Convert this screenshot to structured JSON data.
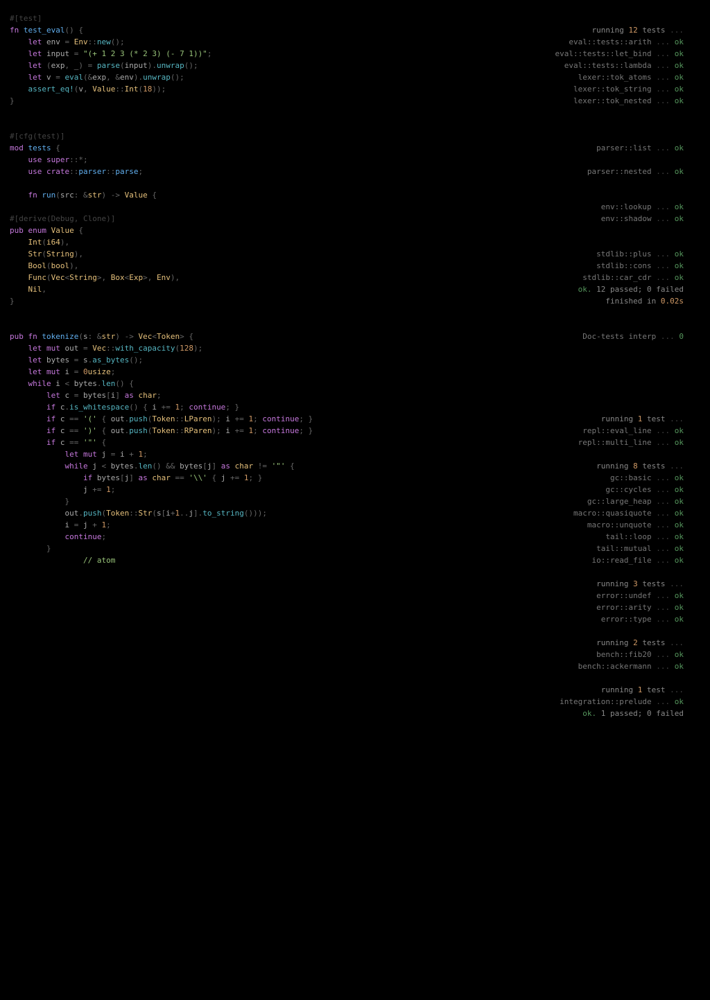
{
  "left": {
    "block1": [
      "#[test]",
      "fn test_eval() {",
      "    let env = Env::new();",
      "    let input = \"(+ 1 2 3 (* 2 3) (- 7 1))\";",
      "    let (exp, _) = parse(input).unwrap();",
      "    let v = eval(&exp, &env).unwrap();",
      "    assert_eq!(v, Value::Int(18));",
      "}"
    ],
    "block2": [
      "",
      "",
      "#[cfg(test)]",
      "mod tests {",
      "    use super::*;",
      "    use crate::parser::parse;"
    ],
    "block3": [
      "",
      "    fn run(src: &str) -> Value {"
    ],
    "block4": [
      "",
      "#[derive(Debug, Clone)]",
      "pub enum Value {",
      "    Int(i64),",
      "    Str(String),",
      "    Bool(bool),",
      "    Func(Vec<String>, Box<Exp>, Env),",
      "    Nil,",
      "}"
    ],
    "block5": [
      "",
      "",
      "pub fn tokenize(s: &str) -> Vec<Token> {",
      "    let mut out = Vec::with_capacity(128);",
      "    let bytes = s.as_bytes();",
      "    let mut i = 0usize;",
      "    while i < bytes.len() {",
      "        let c = bytes[i] as char;",
      "        if c.is_whitespace() { i += 1; continue; }",
      "        if c == '(' { out.push(Token::LParen); i += 1; continue; }",
      "        if c == ')' { out.push(Token::RParen); i += 1; continue; }",
      "        if c == '\"' {",
      "            let mut j = i + 1;",
      "            while j < bytes.len() && bytes[j] as char != '\"' {",
      "                if bytes[j] as char == '\\\\' { j += 1; }",
      "                j += 1;",
      "            }",
      "            out.push(Token::Str(s[i+1..j].to_string()));",
      "            i = j + 1;",
      "            continue;",
      "        }",
      "        // atom"
    ]
  },
  "right": {
    "rows": [
      {
        "kind": "blank"
      },
      {
        "kind": "run",
        "label": "running",
        "count": "12",
        "word": "tests",
        "dots": "..."
      },
      {
        "kind": "ok",
        "loc": "eval::tests::arith",
        "res": "ok"
      },
      {
        "kind": "ok",
        "loc": "eval::tests::let_bind",
        "res": "ok"
      },
      {
        "kind": "ok",
        "loc": "eval::tests::lambda",
        "res": "ok"
      },
      {
        "kind": "ok",
        "loc": "lexer::tok_atoms",
        "res": "ok"
      },
      {
        "kind": "ok",
        "loc": "lexer::tok_string",
        "res": "ok"
      },
      {
        "kind": "ok",
        "loc": "lexer::tok_nested",
        "res": "ok"
      },
      {
        "kind": "blank"
      },
      {
        "kind": "blank"
      },
      {
        "kind": "blank"
      },
      {
        "kind": "ok",
        "loc": "parser::list",
        "res": "ok"
      },
      {
        "kind": "blank"
      },
      {
        "kind": "ok",
        "loc": "parser::nested",
        "res": "ok"
      },
      {
        "kind": "blank"
      },
      {
        "kind": "blank"
      },
      {
        "kind": "ok",
        "loc": "env::lookup",
        "res": "ok"
      },
      {
        "kind": "ok",
        "loc": "env::shadow",
        "res": "ok"
      },
      {
        "kind": "blank"
      },
      {
        "kind": "blank"
      },
      {
        "kind": "ok",
        "loc": "stdlib::plus",
        "res": "ok"
      },
      {
        "kind": "ok",
        "loc": "stdlib::cons",
        "res": "ok"
      },
      {
        "kind": "ok",
        "loc": "stdlib::car_cdr",
        "res": "ok"
      },
      {
        "kind": "sum",
        "label": "ok.",
        "counts": "12 passed; 0 failed"
      },
      {
        "kind": "time",
        "head": "finished in",
        "val": "0.02s"
      },
      {
        "kind": "blank"
      },
      {
        "kind": "blank"
      },
      {
        "kind": "doc",
        "loc": "Doc-tests interp",
        "res": "0"
      },
      {
        "kind": "blank"
      },
      {
        "kind": "blank"
      },
      {
        "kind": "blank"
      },
      {
        "kind": "blank"
      },
      {
        "kind": "blank"
      },
      {
        "kind": "blank"
      },
      {
        "kind": "run",
        "label": "running",
        "count": "1",
        "word": "test",
        "dots": "..."
      },
      {
        "kind": "ok",
        "loc": "repl::eval_line",
        "res": "ok"
      },
      {
        "kind": "ok",
        "loc": "repl::multi_line",
        "res": "ok"
      },
      {
        "kind": "blank"
      },
      {
        "kind": "run",
        "label": "running",
        "count": "8",
        "word": "tests",
        "dots": "..."
      },
      {
        "kind": "ok",
        "loc": "gc::basic",
        "res": "ok"
      },
      {
        "kind": "ok",
        "loc": "gc::cycles",
        "res": "ok"
      },
      {
        "kind": "ok",
        "loc": "gc::large_heap",
        "res": "ok"
      },
      {
        "kind": "ok",
        "loc": "macro::quasiquote",
        "res": "ok"
      },
      {
        "kind": "ok",
        "loc": "macro::unquote",
        "res": "ok"
      },
      {
        "kind": "ok",
        "loc": "tail::loop",
        "res": "ok"
      },
      {
        "kind": "ok",
        "loc": "tail::mutual",
        "res": "ok"
      },
      {
        "kind": "ok",
        "loc": "io::read_file",
        "res": "ok"
      },
      {
        "kind": "blank"
      },
      {
        "kind": "run",
        "label": "running",
        "count": "3",
        "word": "tests",
        "dots": "..."
      },
      {
        "kind": "ok",
        "loc": "error::undef",
        "res": "ok"
      },
      {
        "kind": "ok",
        "loc": "error::arity",
        "res": "ok"
      },
      {
        "kind": "ok",
        "loc": "error::type",
        "res": "ok"
      },
      {
        "kind": "blank"
      },
      {
        "kind": "run",
        "label": "running",
        "count": "2",
        "word": "tests",
        "dots": "..."
      },
      {
        "kind": "ok",
        "loc": "bench::fib20",
        "res": "ok"
      },
      {
        "kind": "ok",
        "loc": "bench::ackermann",
        "res": "ok"
      },
      {
        "kind": "blank"
      },
      {
        "kind": "run",
        "label": "running",
        "count": "1",
        "word": "test",
        "dots": "..."
      },
      {
        "kind": "ok",
        "loc": "integration::prelude",
        "res": "ok"
      },
      {
        "kind": "sum",
        "label": "ok.",
        "counts": "1 passed; 0 failed"
      }
    ]
  }
}
